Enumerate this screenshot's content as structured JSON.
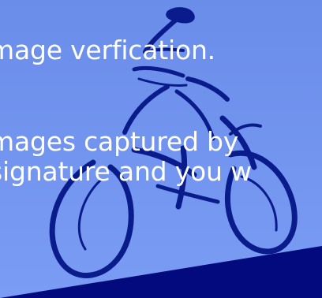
{
  "colors": {
    "background_top": "#6a8dea",
    "background_bottom": "#7a9cf4",
    "ink": "#0a1c8c",
    "text": "#ffffff",
    "ground": "#030a7e"
  },
  "illustration": {
    "icon": "cyclist-brush-drawing"
  },
  "intro": {
    "line1": "mage verfication.",
    "line2": "mages captured by",
    "line3": "signature and you w"
  }
}
